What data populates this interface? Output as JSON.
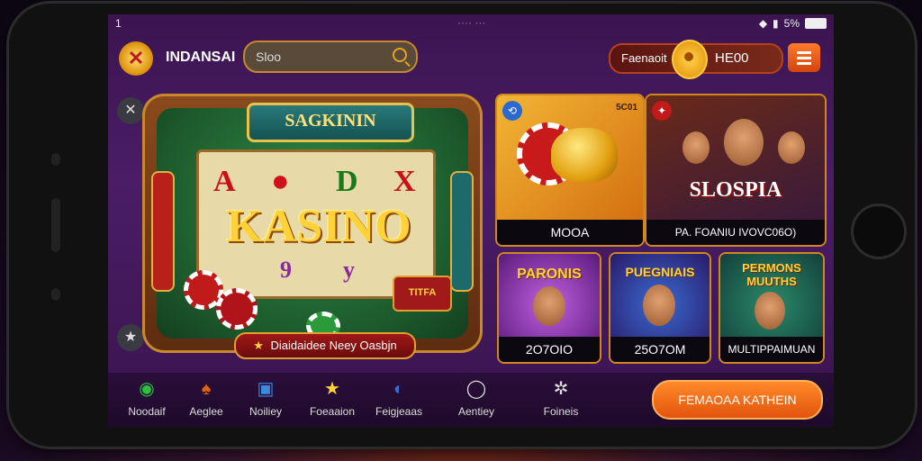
{
  "status": {
    "time": "1",
    "center": "···· ···",
    "battery": "5%"
  },
  "header": {
    "brand": "INDANSAI",
    "search_placeholder": "Sloo",
    "balance_label": "Faenaoit",
    "balance_value": "HE00"
  },
  "feature": {
    "banner": "SAGKININ",
    "reel_symbols": [
      "A",
      "D",
      "X",
      "9",
      "y"
    ],
    "title": "KASINO",
    "button": "Diaidaidee Neey Oasbjn",
    "chip_label": "TITFA"
  },
  "cards": [
    {
      "badge": "5C01",
      "caption": "MOOA"
    },
    {
      "title": "SLOSPIA",
      "caption": "PA. FOANIU IVOVC06O)"
    },
    {
      "title": "PARONIS",
      "caption": "2O7OIO"
    },
    {
      "title": "PUEGNIAIS",
      "caption": "25O7OM"
    },
    {
      "title": "PERMONS MUUTHS",
      "caption": "MULTIPPAIMUAN"
    }
  ],
  "nav": [
    {
      "label": "Noodaif",
      "icon": "controller-icon"
    },
    {
      "label": "Aeglee",
      "icon": "cards-icon"
    },
    {
      "label": "Noiliey",
      "icon": "book-icon"
    },
    {
      "label": "Foeaaion",
      "icon": "star-icon"
    },
    {
      "label": "Feigjeaas",
      "icon": "globe-icon"
    },
    {
      "label": "Aentiey",
      "icon": "ring-icon"
    },
    {
      "label": "Foineis",
      "icon": "gear-icon"
    }
  ],
  "play_button": "FEMAOAA KATHEIN",
  "colors": {
    "accent": "#e2540c",
    "gold": "#ffd23a",
    "frame": "#d1871f"
  }
}
